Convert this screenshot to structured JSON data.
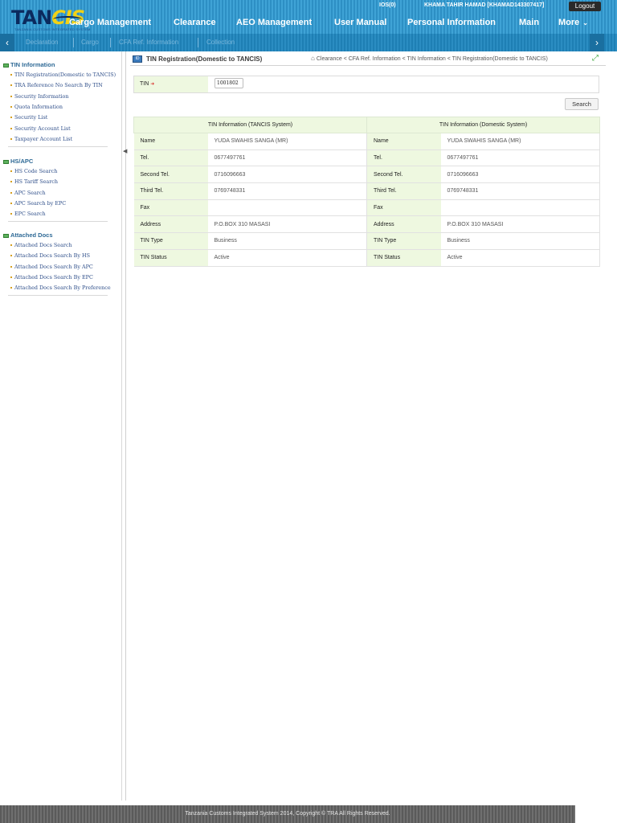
{
  "header": {
    "logo_main": "TAN",
    "logo_accent": "CIS",
    "logo_sub": "TANZANIA CUSTOMS INTEGRATED SYSTEM",
    "ios": "IOS(0)",
    "user": "KHAMA TAHIR HAMAD [KHAMAD143307417]",
    "logout": "Logout",
    "nav": [
      "Cargo Management",
      "Clearance",
      "AEO Management",
      "User Manual",
      "Personal Information",
      "Main",
      "More"
    ]
  },
  "subnav": {
    "items": [
      "Declaration",
      "Cargo",
      "CFA Ref. Information",
      "Collection"
    ]
  },
  "sidebar": {
    "groups": [
      {
        "title": "TIN Information",
        "items": [
          "TIN Registration(Domestic to TANCIS)",
          "TRA Reference No Search By TIN",
          "Security Information",
          "Quota Information",
          "Security List",
          "Security Account List",
          "Taxpayer Account List"
        ]
      },
      {
        "title": "HS/APC",
        "items": [
          "HS Code Search",
          "HS Tariff Search",
          "APC Search",
          "APC Search by EPC",
          "EPC Search"
        ]
      },
      {
        "title": "Attached Docs",
        "items": [
          "Attached Docs Search",
          "Attached Docs Search By HS",
          "Attached Docs Search By APC",
          "Attached Docs Search By EPC",
          "Attached Docs Search By Preference"
        ]
      }
    ]
  },
  "page": {
    "title": "TIN Registration(Domestic to TANCIS)",
    "breadcrumb": "Clearance < CFA Ref. Information < TIN Information < TIN Registration(Domestic to TANCIS)",
    "tin_label": "TIN",
    "tin_value": "1001802",
    "search_label": "Search"
  },
  "table": {
    "headers": [
      "TIN Information (TANCIS System)",
      "TIN Information (Domestic System)"
    ],
    "rows": [
      {
        "label": "Name",
        "tancis": "YUDA SWAHIS SANGA (MR)",
        "domestic": "YUDA SWAHIS SANGA (MR)"
      },
      {
        "label": "Tel.",
        "tancis": "0677497761",
        "domestic": "0677497761"
      },
      {
        "label": "Second Tel.",
        "tancis": "0716096663",
        "domestic": "0716096663"
      },
      {
        "label": "Third Tel.",
        "tancis": "0769748331",
        "domestic": "0769748331"
      },
      {
        "label": "Fax",
        "tancis": "",
        "domestic": ""
      },
      {
        "label": "Address",
        "tancis": "P.O.BOX 310 MASASI",
        "domestic": "P.O.BOX 310 MASASI"
      },
      {
        "label": "TIN Type",
        "tancis": "Business",
        "domestic": "Business"
      },
      {
        "label": "TIN Status",
        "tancis": "Active",
        "domestic": "Active"
      }
    ]
  },
  "footer": {
    "text": "Tanzania Customs Integrated System 2014, Copyright © TRA All Rights Reserved."
  }
}
